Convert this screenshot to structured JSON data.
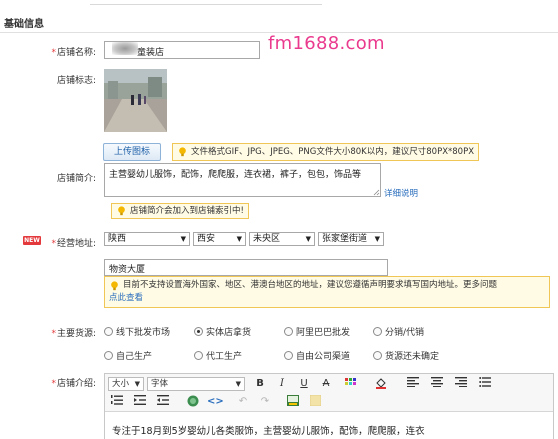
{
  "watermark": "fm1688.com",
  "section": {
    "title": "基础信息"
  },
  "store_name": {
    "label": "店铺名称:",
    "value": "童装店"
  },
  "store_logo": {
    "label": "店铺标志:",
    "upload_button": "上传图标",
    "tip": "文件格式GIF、JPG、JPEG、PNG文件大小80K以内，建议尺寸80PX*80PX"
  },
  "store_intro": {
    "label": "店铺简介:",
    "value": "主营婴幼儿服饰，配饰，爬爬服，连衣裙，裤子，包包，饰品等",
    "detail_link": "详细说明",
    "tip": "店铺简介会加入到店铺索引中!"
  },
  "address": {
    "badge": "NEW",
    "label": "经营地址:",
    "province": "陕西",
    "city": "西安",
    "district": "未央区",
    "street": "张家堡街道",
    "detail": "物资大厦",
    "tip_line1": "目前不支持设置海外国家、地区、港澳台地区的地址，建议您遵循声明要求填写国内地址。更多问题",
    "tip_link": "点此查看"
  },
  "supply": {
    "label": "主要货源:",
    "options": [
      {
        "label": "线下批发市场",
        "selected": false
      },
      {
        "label": "实体店拿货",
        "selected": true
      },
      {
        "label": "阿里巴巴批发",
        "selected": false
      },
      {
        "label": "分销/代销",
        "selected": false
      },
      {
        "label": "自己生产",
        "selected": false
      },
      {
        "label": "代工生产",
        "selected": false
      },
      {
        "label": "自由公司渠道",
        "selected": false
      },
      {
        "label": "货源还未确定",
        "selected": false
      }
    ]
  },
  "store_desc": {
    "label": "店铺介绍:",
    "font_size_select": "大小",
    "font_family_select": "字体",
    "content": "专注于18月到5岁婴幼儿各类服饰，主营婴幼儿服饰，配饰，爬爬服，连衣"
  },
  "colors": {
    "required": "#e4393c",
    "link": "#2a6ebd",
    "tip_bg": "#fffbe5",
    "tip_border": "#f0c656",
    "watermark": "#ea3a8e"
  }
}
